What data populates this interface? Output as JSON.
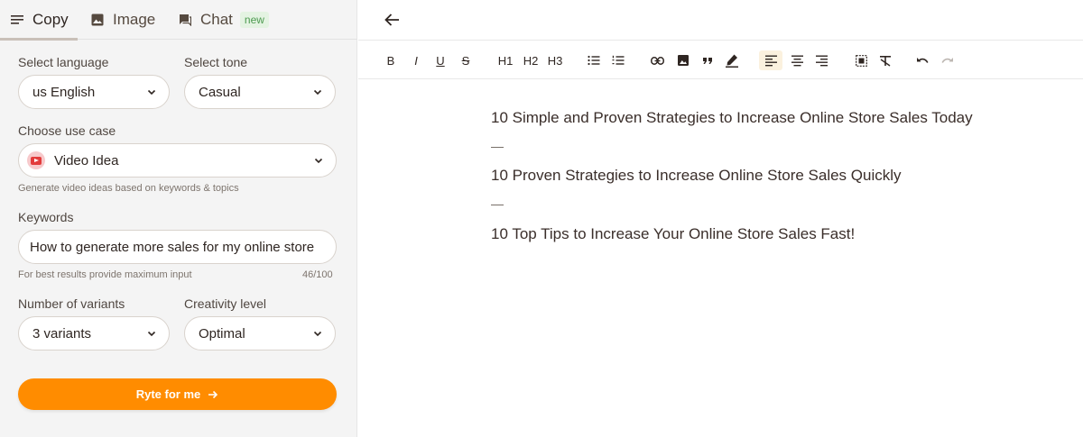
{
  "tabs": [
    {
      "label": "Copy",
      "icon": "menu-icon",
      "active": true
    },
    {
      "label": "Image",
      "icon": "image-icon"
    },
    {
      "label": "Chat",
      "icon": "chat-icon",
      "badge": "new"
    }
  ],
  "form": {
    "language": {
      "label": "Select language",
      "value": "us English"
    },
    "tone": {
      "label": "Select tone",
      "value": "Casual"
    },
    "use_case": {
      "label": "Choose use case",
      "value": "Video Idea",
      "icon": "youtube-icon",
      "hint": "Generate video ideas based on keywords & topics"
    },
    "keywords": {
      "label": "Keywords",
      "value": "How to generate more sales for my online store",
      "hint": "For best results provide maximum input",
      "count": "46/100"
    },
    "variants": {
      "label": "Number of variants",
      "value": "3 variants"
    },
    "creativity": {
      "label": "Creativity level",
      "value": "Optimal"
    },
    "submit_label": "Ryte for me",
    "submit_icon": "arrow-right-icon",
    "accent_color": "#ff8c00"
  },
  "toolbar": {
    "back_icon": "arrow-left-icon",
    "bold": "B",
    "italic": "I",
    "underline": "U",
    "strike": "S",
    "h1": "H1",
    "h2": "H2",
    "h3": "H3",
    "active_align": "align-left"
  },
  "editor": {
    "lines": [
      "10 Simple and Proven Strategies to Increase Online Store Sales Today",
      "10 Proven Strategies to Increase Online Store Sales Quickly",
      "10 Top Tips to Increase Your Online Store Sales Fast!"
    ],
    "separator": "—"
  }
}
